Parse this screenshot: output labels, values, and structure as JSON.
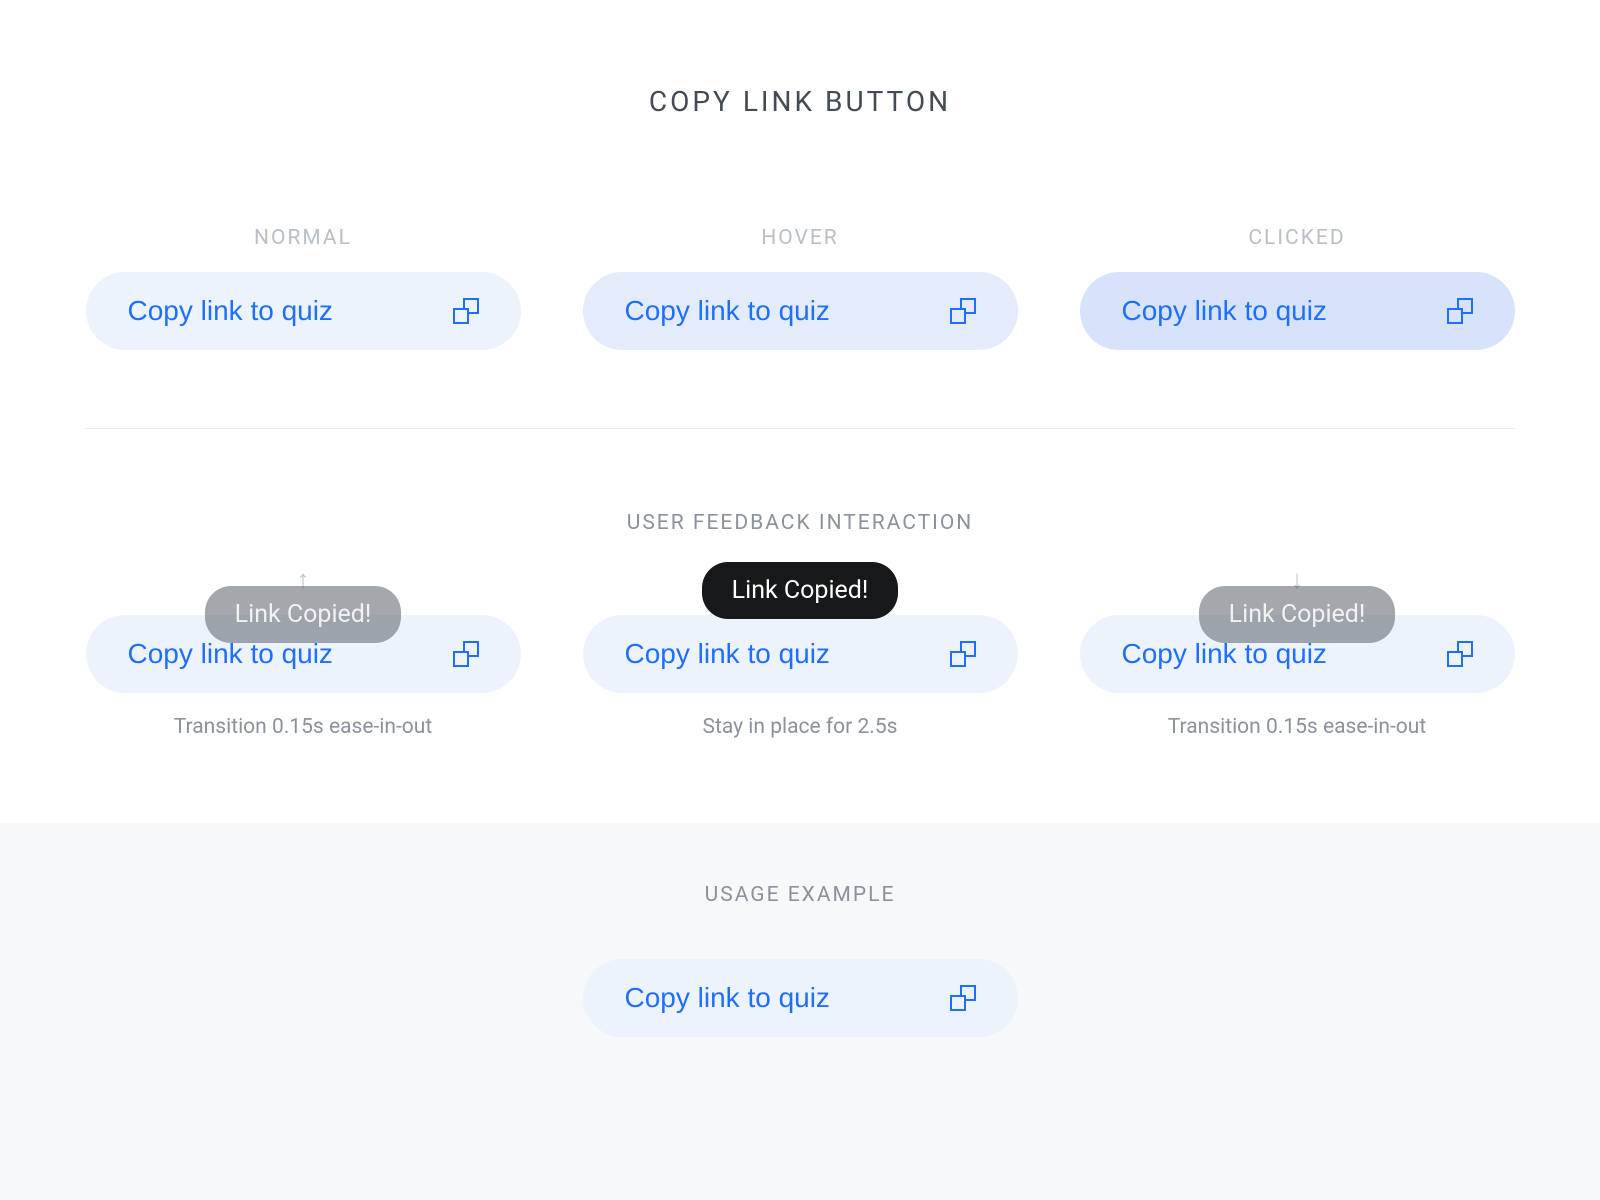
{
  "page": {
    "title": "COPY LINK BUTTON"
  },
  "states": {
    "normal": {
      "label": "NORMAL",
      "button_label": "Copy link to quiz"
    },
    "hover": {
      "label": "HOVER",
      "button_label": "Copy link to quiz"
    },
    "clicked": {
      "label": "CLICKED",
      "button_label": "Copy link to quiz"
    }
  },
  "feedback": {
    "title": "USER FEEDBACK INTERACTION",
    "toast_text": "Link Copied!",
    "steps": {
      "rise": {
        "button_label": "Copy link to quiz",
        "toast_text": "Link Copied!",
        "caption": "Transition 0.15s ease-in-out",
        "arrow": "↑"
      },
      "hold": {
        "button_label": "Copy link to quiz",
        "toast_text": "Link Copied!",
        "caption": "Stay in place for 2.5s"
      },
      "fall": {
        "button_label": "Copy link to quiz",
        "toast_text": "Link Copied!",
        "caption": "Transition 0.15s ease-in-out",
        "arrow": "↓"
      }
    }
  },
  "usage": {
    "title": "USAGE EXAMPLE",
    "button_label": "Copy link to quiz"
  }
}
